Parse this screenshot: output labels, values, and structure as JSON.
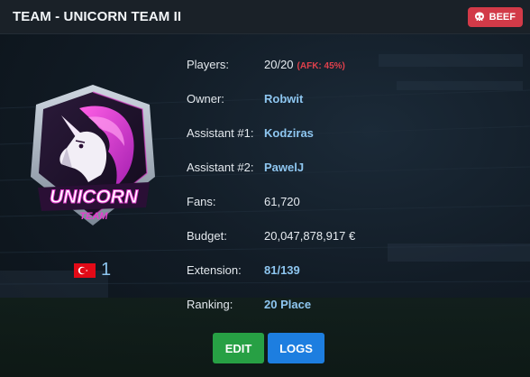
{
  "header": {
    "title": "TEAM - UNICORN TEAM II",
    "tag_label": "BEEF",
    "tag_icon": "skull-icon",
    "tag_color": "#d23a48"
  },
  "logo": {
    "text_main": "UNICORN",
    "text_sub": "TEAM",
    "accent": "#e43fd0"
  },
  "country": {
    "flag": "turkey-flag-icon",
    "number": "1"
  },
  "info": {
    "players_label": "Players:",
    "players_value": "20/20",
    "players_afk": "(AFK: 45%)",
    "owner_label": "Owner:",
    "owner_value": "Robwit",
    "assistant1_label": "Assistant #1:",
    "assistant1_value": "Kodziras",
    "assistant2_label": "Assistant #2:",
    "assistant2_value": "PawelJ",
    "fans_label": "Fans:",
    "fans_value": "61,720",
    "budget_label": "Budget:",
    "budget_value": "20,047,878,917 €",
    "extension_label": "Extension:",
    "extension_value": "81/139",
    "ranking_label": "Ranking:",
    "ranking_value": "20 Place"
  },
  "actions": {
    "edit_label": "EDIT",
    "logs_label": "LOGS",
    "edit_color": "#27a044",
    "logs_color": "#1d7ee0"
  },
  "colors": {
    "link": "#8ec6f0",
    "afk": "#e0404c"
  }
}
